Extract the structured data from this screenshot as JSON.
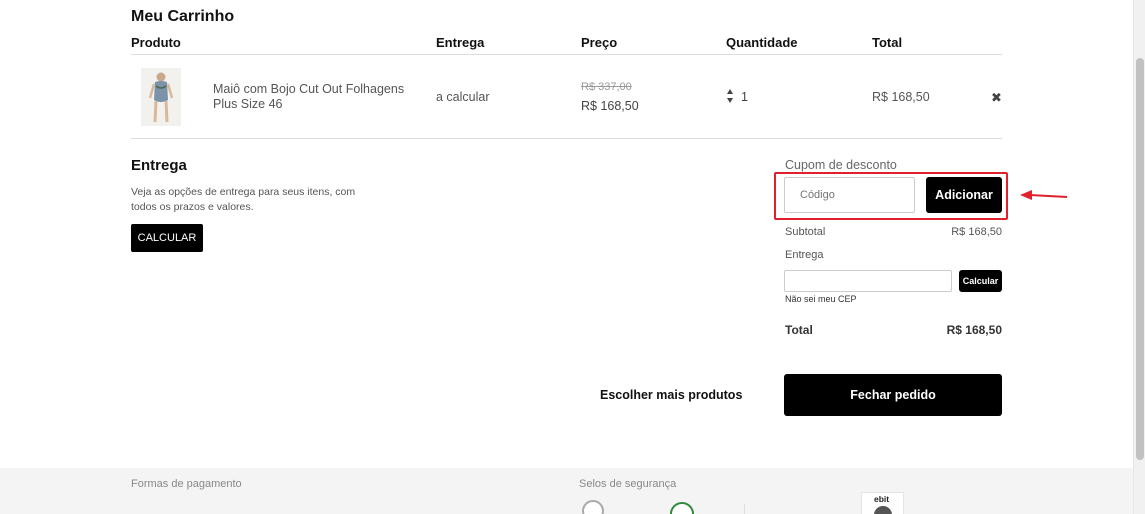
{
  "cart": {
    "title": "Meu Carrinho",
    "columns": [
      "Produto",
      "Entrega",
      "Preço",
      "Quantidade",
      "Total"
    ],
    "items": [
      {
        "name": "Maiô com Bojo Cut Out Folhagens Plus Size 46",
        "delivery": "a calcular",
        "old_price": "R$ 337,00",
        "price": "R$ 168,50",
        "quantity": "1",
        "total": "R$ 168,50"
      }
    ],
    "remove_icon": "✖"
  },
  "shipping": {
    "title": "Entrega",
    "description": "Veja as opções de entrega para seus itens, com todos os prazos e valores.",
    "calc_button": "CALCULAR"
  },
  "coupon": {
    "label": "Cupom de desconto",
    "placeholder": "Código",
    "button": "Adicionar"
  },
  "summary": {
    "subtotal_label": "Subtotal",
    "subtotal_value": "R$ 168,50",
    "delivery_label": "Entrega",
    "cep_button": "Calcular",
    "cep_link": "Não sei meu CEP",
    "total_label": "Total",
    "total_value": "R$ 168,50"
  },
  "actions": {
    "more_products": "Escolher mais produtos",
    "checkout": "Fechar pedido"
  },
  "footer": {
    "payment_label": "Formas de pagamento",
    "security_label": "Selos de segurança",
    "ebit_text": "ebit"
  },
  "colors": {
    "annotation": "#e0202a",
    "button": "#000000"
  }
}
